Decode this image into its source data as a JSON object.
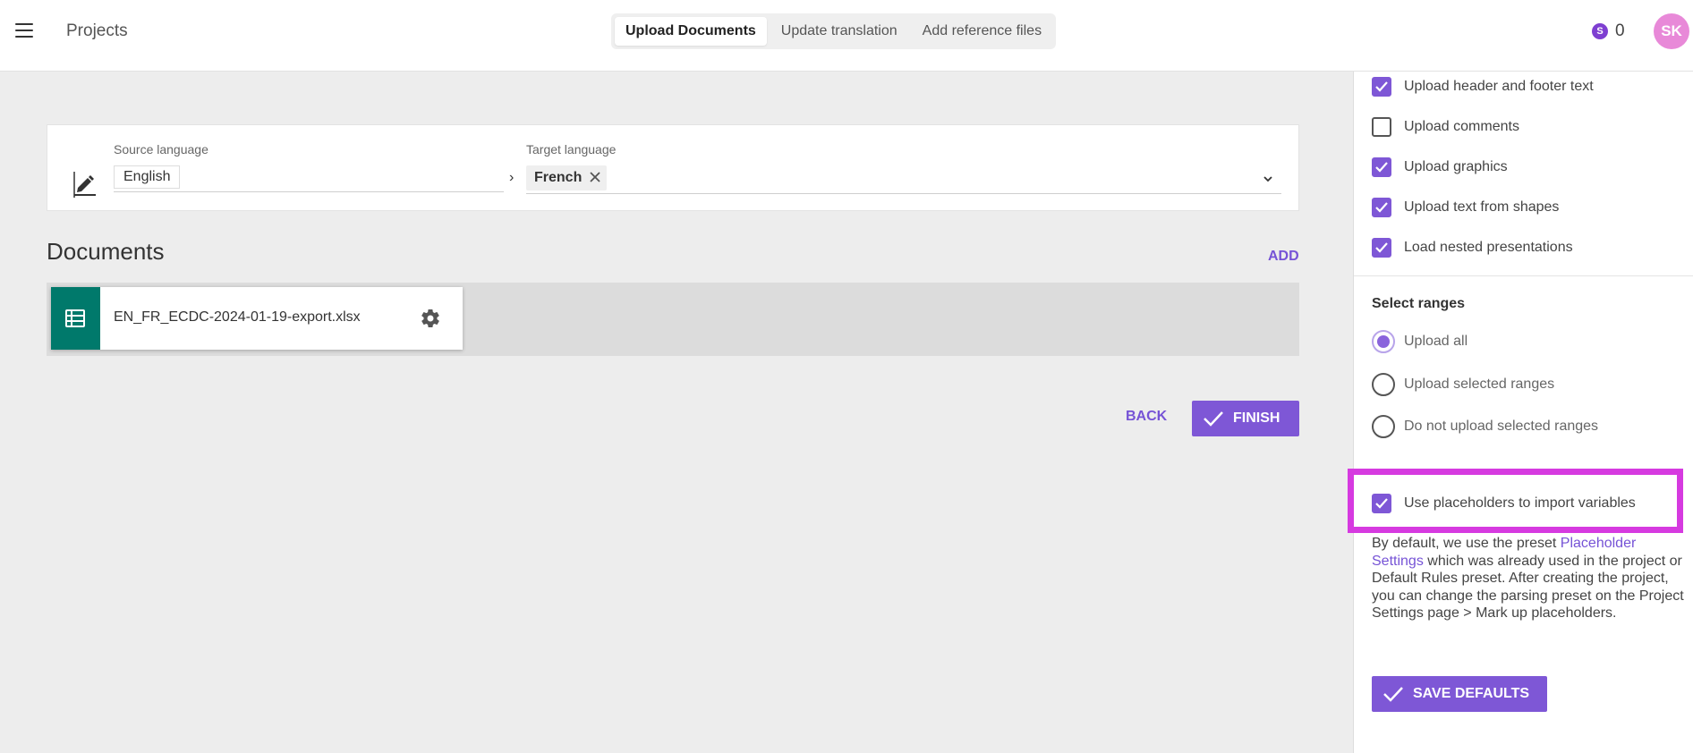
{
  "header": {
    "title": "Projects",
    "tabs": [
      {
        "label": "Upload Documents",
        "active": true
      },
      {
        "label": "Update translation",
        "active": false
      },
      {
        "label": "Add reference files",
        "active": false
      }
    ],
    "credits_icon_letter": "S",
    "credits_count": "0",
    "avatar_initials": "SK"
  },
  "languages": {
    "source_label": "Source language",
    "source_value": "English",
    "target_label": "Target language",
    "target_value": "French"
  },
  "documents": {
    "title": "Documents",
    "add_label": "ADD",
    "items": [
      {
        "name": "EN_FR_ECDC-2024-01-19-export.xlsx"
      }
    ]
  },
  "actions": {
    "back_label": "BACK",
    "finish_label": "FINISH"
  },
  "panel": {
    "checkboxes": [
      {
        "label": "Upload header and footer text",
        "checked": true
      },
      {
        "label": "Upload comments",
        "checked": false
      },
      {
        "label": "Upload graphics",
        "checked": true
      },
      {
        "label": "Upload text from shapes",
        "checked": true
      },
      {
        "label": "Load nested presentations",
        "checked": true
      }
    ],
    "ranges_title": "Select ranges",
    "ranges": [
      {
        "label": "Upload all",
        "selected": true
      },
      {
        "label": "Upload selected ranges",
        "selected": false
      },
      {
        "label": "Do not upload selected ranges",
        "selected": false
      }
    ],
    "placeholders": {
      "label": "Use placeholders to import variables",
      "checked": true
    },
    "desc_before": "By default, we use the preset ",
    "desc_link": "Placeholder Settings",
    "desc_after": " which was already used in the project or Default Rules preset. After creating the project, you can change the parsing preset on the Project Settings page > Mark up placeholders.",
    "save_label": "SAVE DEFAULTS"
  },
  "colors": {
    "accent": "#7e57d6",
    "highlight": "#d63ae0",
    "doc_icon": "#00796b",
    "avatar": "#e889d8"
  }
}
